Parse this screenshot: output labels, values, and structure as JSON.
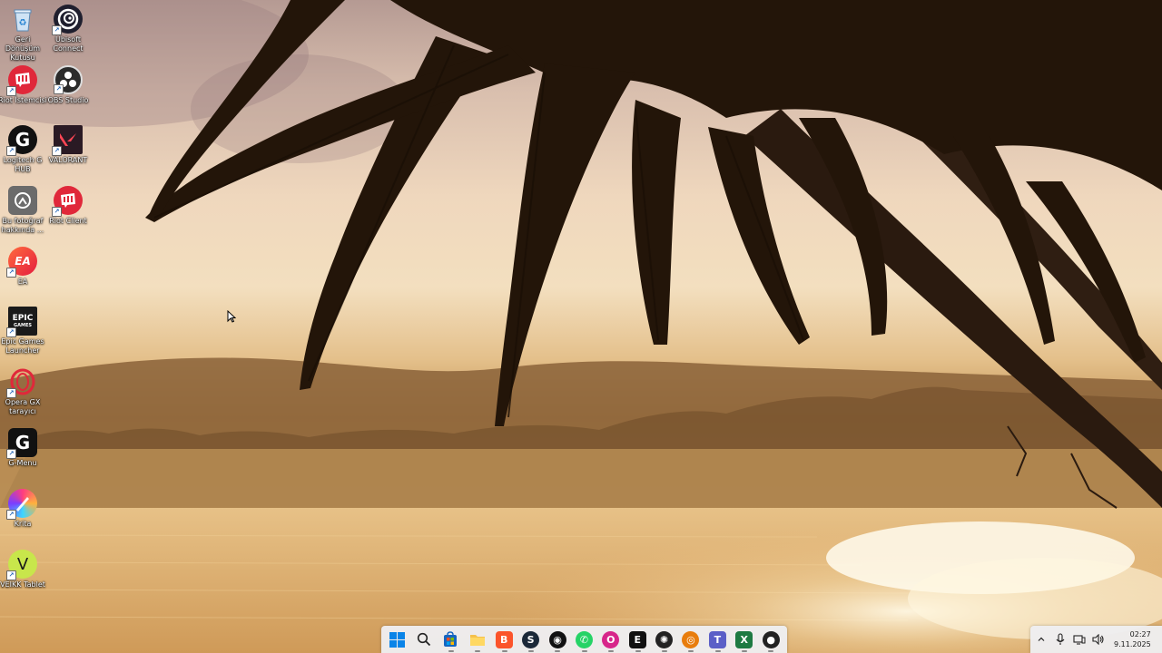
{
  "desktop": {
    "icons": [
      {
        "label": "Geri Dönüşüm Kutusu",
        "icon": "recycle-bin-icon"
      },
      {
        "label": "Ubisoft Connect",
        "icon": "ubisoft-icon"
      },
      {
        "label": "Riot İstemcisi",
        "icon": "riot-client-icon"
      },
      {
        "label": "OBS Studio",
        "icon": "obs-icon"
      },
      {
        "label": "Logitech G HUB",
        "icon": "logitech-icon"
      },
      {
        "label": "VALORANT",
        "icon": "valorant-icon"
      },
      {
        "label": "Bu fotoğraf hakkında ...",
        "icon": "about-photo-icon"
      },
      {
        "label": "Riot Client",
        "icon": "riot-client-icon"
      },
      {
        "label": "EA",
        "icon": "ea-icon"
      },
      {
        "label": "Epic Games Launcher",
        "icon": "epic-games-icon"
      },
      {
        "label": "Opera GX tarayıcı",
        "icon": "opera-gx-icon"
      },
      {
        "label": "G-Menu",
        "icon": "g-menu-icon"
      },
      {
        "label": "Krita",
        "icon": "krita-icon"
      },
      {
        "label": "VEIKK Tablet",
        "icon": "veikk-icon"
      }
    ]
  },
  "taskbar": {
    "apps": [
      {
        "name": "start",
        "icon": "windows-start-icon",
        "glyph": "",
        "color": "#0a84e8"
      },
      {
        "name": "search",
        "icon": "search-icon",
        "glyph": "",
        "color": "#222222"
      },
      {
        "name": "store",
        "icon": "microsoft-store-icon",
        "glyph": "",
        "color": "#1565c0"
      },
      {
        "name": "file-explorer",
        "icon": "folder-icon",
        "glyph": "",
        "color": "#f5c14b"
      },
      {
        "name": "brave",
        "icon": "brave-icon",
        "glyph": "B",
        "color": "#fb542b"
      },
      {
        "name": "steam",
        "icon": "steam-icon",
        "glyph": "S",
        "color": "#1b2838"
      },
      {
        "name": "messenger",
        "icon": "chat-icon",
        "glyph": "◉",
        "color": "#111111"
      },
      {
        "name": "whatsapp",
        "icon": "whatsapp-icon",
        "glyph": "✆",
        "color": "#25d366"
      },
      {
        "name": "opera-gx",
        "icon": "opera-gx-icon",
        "glyph": "O",
        "color": "#d7268a"
      },
      {
        "name": "epic-games",
        "icon": "epic-games-icon",
        "glyph": "E",
        "color": "#111111"
      },
      {
        "name": "chatgpt",
        "icon": "chatgpt-icon",
        "glyph": "✺",
        "color": "#222222"
      },
      {
        "name": "blender",
        "icon": "blender-icon",
        "glyph": "◎",
        "color": "#e87d0d"
      },
      {
        "name": "teams",
        "icon": "teams-icon",
        "glyph": "T",
        "color": "#5b5fc7"
      },
      {
        "name": "excel",
        "icon": "excel-icon",
        "glyph": "X",
        "color": "#1d7a42"
      },
      {
        "name": "obs",
        "icon": "obs-icon",
        "glyph": "●",
        "color": "#222222"
      }
    ],
    "tray": {
      "time": "02:27",
      "date": "9.11.2025"
    }
  },
  "colors": {
    "accent": "#0a84e8",
    "taskbar_bg": "#eeeef0"
  }
}
